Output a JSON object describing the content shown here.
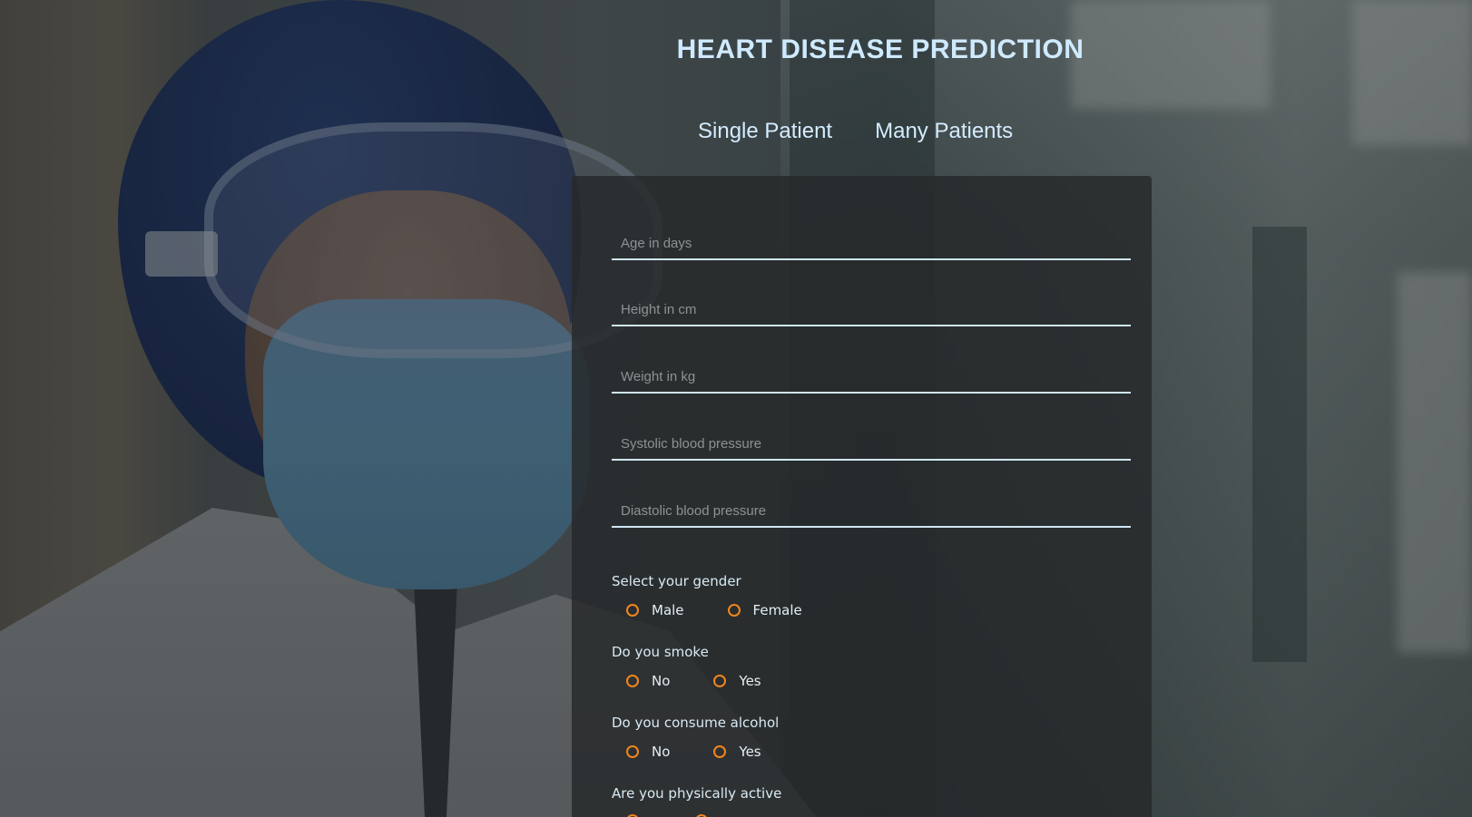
{
  "page": {
    "title": "HEART DISEASE PREDICTION",
    "accent_color": "#f0861c",
    "title_color": "#cfeaff"
  },
  "tabs": [
    {
      "label": "Single Patient"
    },
    {
      "label": "Many Patients"
    }
  ],
  "form": {
    "fields": [
      {
        "placeholder": "Age in days",
        "value": ""
      },
      {
        "placeholder": "Height in cm",
        "value": ""
      },
      {
        "placeholder": "Weight in kg",
        "value": ""
      },
      {
        "placeholder": "Systolic blood pressure",
        "value": ""
      },
      {
        "placeholder": "Diastolic blood pressure",
        "value": ""
      }
    ],
    "groups": [
      {
        "label": "Select your gender",
        "options": [
          "Male",
          "Female"
        ]
      },
      {
        "label": "Do you smoke",
        "options": [
          "No",
          "Yes"
        ]
      },
      {
        "label": "Do you consume alcohol",
        "options": [
          "No",
          "Yes"
        ]
      },
      {
        "label": "Are you physically active",
        "options": [
          "",
          ""
        ]
      }
    ]
  }
}
